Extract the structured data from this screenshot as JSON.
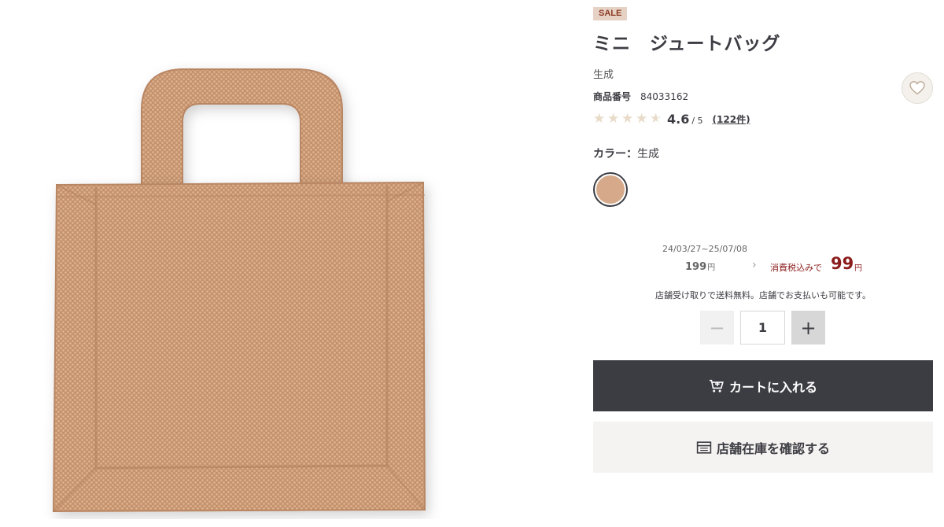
{
  "product": {
    "badge": "SALE",
    "title": "ミニ　ジュートバッグ",
    "subtitle": "生成",
    "number_label": "商品番号",
    "number_value": "84033162"
  },
  "rating": {
    "value": "4.6",
    "max": "/ 5",
    "score": 4.6,
    "reviews": "(122件)"
  },
  "color": {
    "label": "カラー：",
    "value": "生成",
    "swatch_hex": "#d6a98a"
  },
  "price": {
    "period": "24/03/27~25/07/08",
    "old_value": "199",
    "old_unit": "円",
    "new_label": "消費税込みで",
    "new_value": "99",
    "new_unit": "円",
    "accent": "#8c1c1c"
  },
  "shipping_note": "店舗受け取りで送料無料。店舗でお支払いも可能です。",
  "quantity": {
    "minus": "−",
    "value": "1",
    "plus": "+"
  },
  "actions": {
    "cart_label": "カートに入れる",
    "cart_icon": "cart-icon",
    "stock_label": "店舗在庫を確認する",
    "stock_icon": "store-icon"
  },
  "favorite_icon": "heart-icon"
}
